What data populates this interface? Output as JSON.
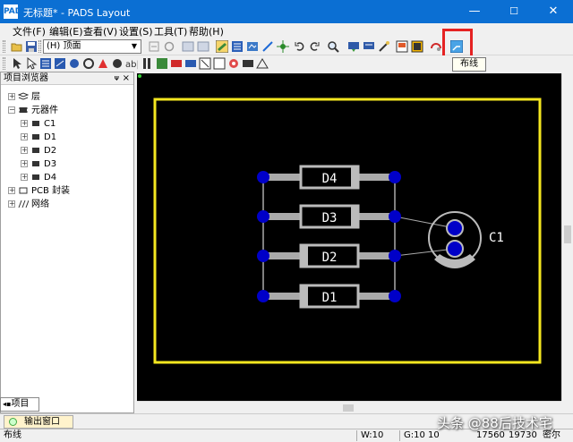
{
  "window": {
    "title": "无标题* - PADS Layout",
    "app_icon": "PADS",
    "min": "—",
    "max": "☐",
    "close": "✕"
  },
  "menu": [
    "文件(F)",
    "编辑(E)",
    "查看(V)",
    "设置(S)",
    "工具(T)",
    "帮助(H)"
  ],
  "toolbar": {
    "layer_combo": "(H) 顶面",
    "tooltip": "布线"
  },
  "project_panel": {
    "title": "项目浏览器",
    "pin": "ᴪ",
    "close": "×",
    "tree": [
      {
        "label": "层",
        "level": 0,
        "exp": "+"
      },
      {
        "label": "元器件",
        "level": 0,
        "exp": "−"
      },
      {
        "label": "C1",
        "level": 1,
        "exp": "+"
      },
      {
        "label": "D1",
        "level": 1,
        "exp": "+"
      },
      {
        "label": "D2",
        "level": 1,
        "exp": "+"
      },
      {
        "label": "D3",
        "level": 1,
        "exp": "+"
      },
      {
        "label": "D4",
        "level": 1,
        "exp": "+"
      },
      {
        "label": "PCB 封装",
        "level": 0,
        "exp": "+"
      },
      {
        "label": "网络",
        "level": 0,
        "exp": "+"
      }
    ],
    "tab": "项目"
  },
  "board": {
    "parts": [
      "D4",
      "D3",
      "D2",
      "D1"
    ],
    "cap": "C1"
  },
  "output": {
    "tab": "输出窗口"
  },
  "status": {
    "mode": "布线",
    "w": "W:10",
    "g": "G:10 10",
    "x": "17560",
    "y": "19730",
    "unit": "密尔"
  },
  "watermark": "头条 @88后技术宅",
  "colors": {
    "titlebar": "#0b6fd3",
    "board_outline": "#f3e61f",
    "pad": "#0000c8",
    "highlight": "#e52222"
  }
}
